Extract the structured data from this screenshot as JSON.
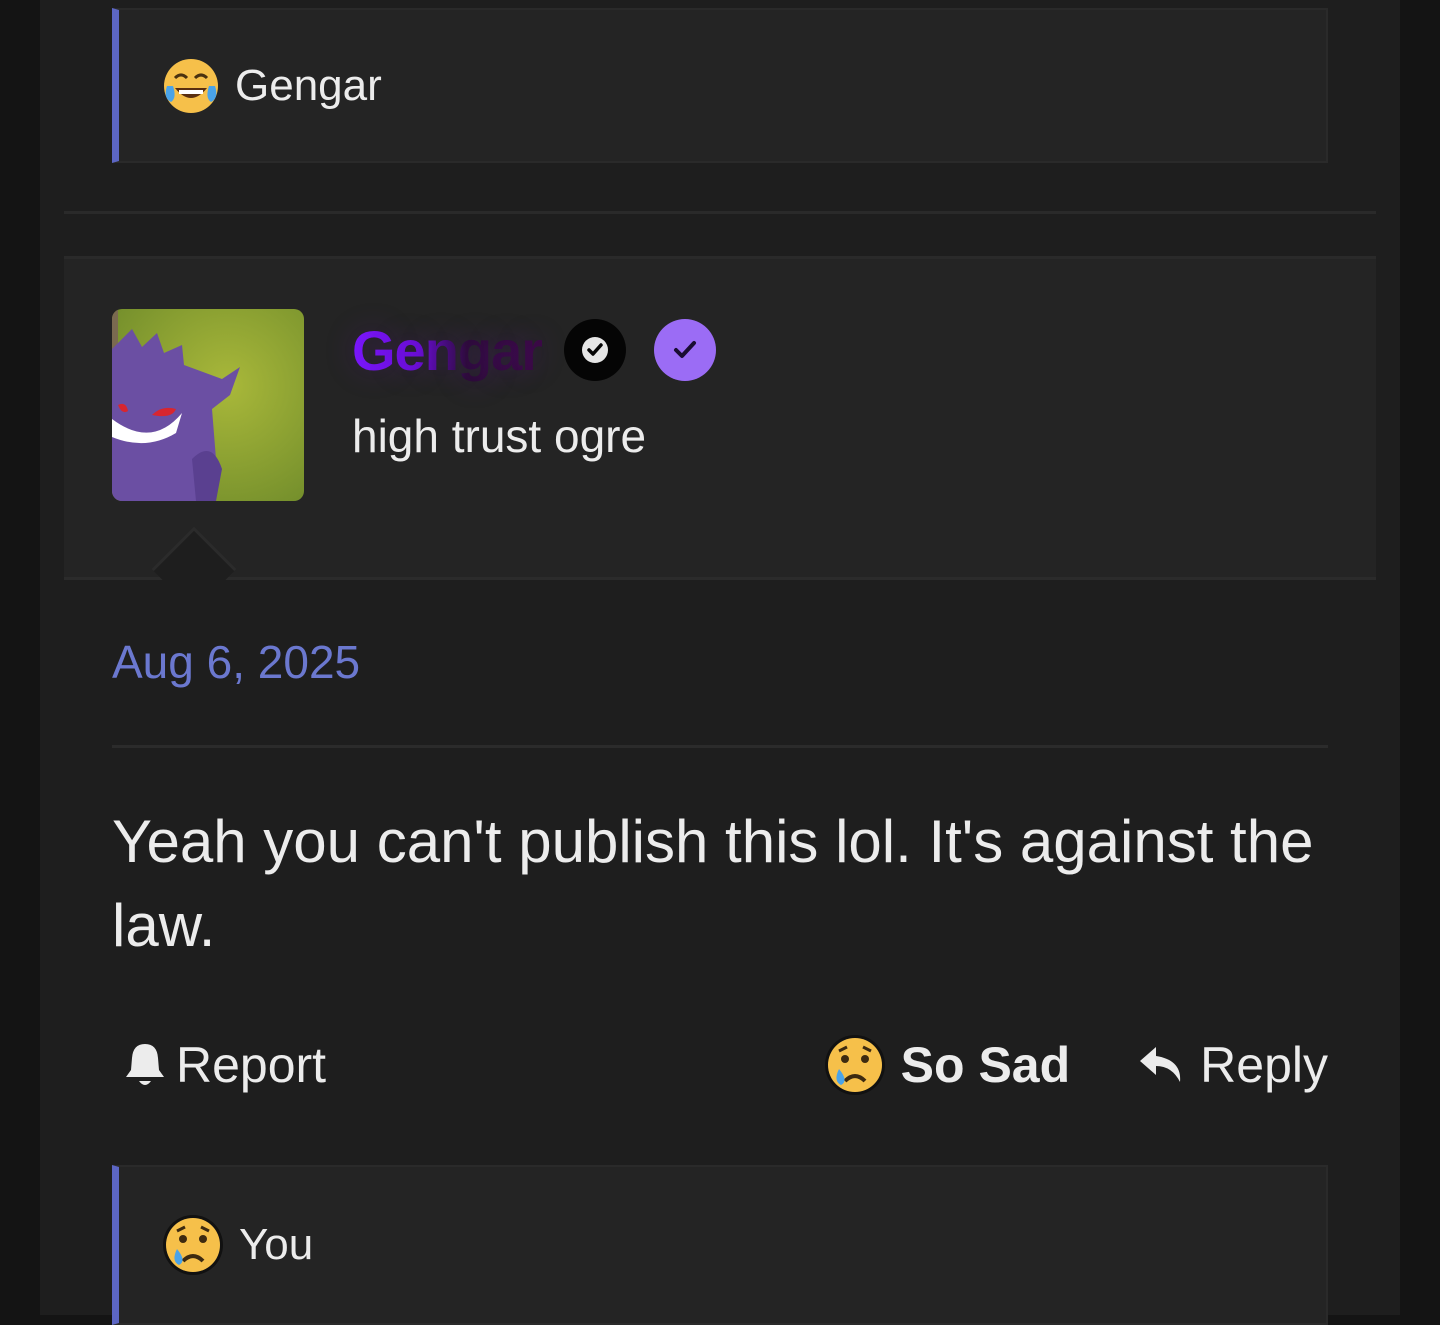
{
  "top_reaction": {
    "emoji": "😂",
    "user": "Gengar"
  },
  "post": {
    "author": {
      "username": "Gengar",
      "title": "high trust ogre",
      "badges": [
        "check-badge-dark",
        "check-badge-purple"
      ]
    },
    "date": "Aug 6, 2025",
    "body": "Yeah you can't publish this lol. It's against the law.",
    "actions": {
      "report_label": "Report",
      "reaction_label": "So Sad",
      "reply_label": "Reply"
    }
  },
  "bottom_reaction": {
    "emoji": "😢",
    "user": "You"
  },
  "colors": {
    "accent": "#5c66c4",
    "date": "#6b78cf",
    "username": "#7a17ff",
    "badge_purple": "#9b6cf5"
  }
}
